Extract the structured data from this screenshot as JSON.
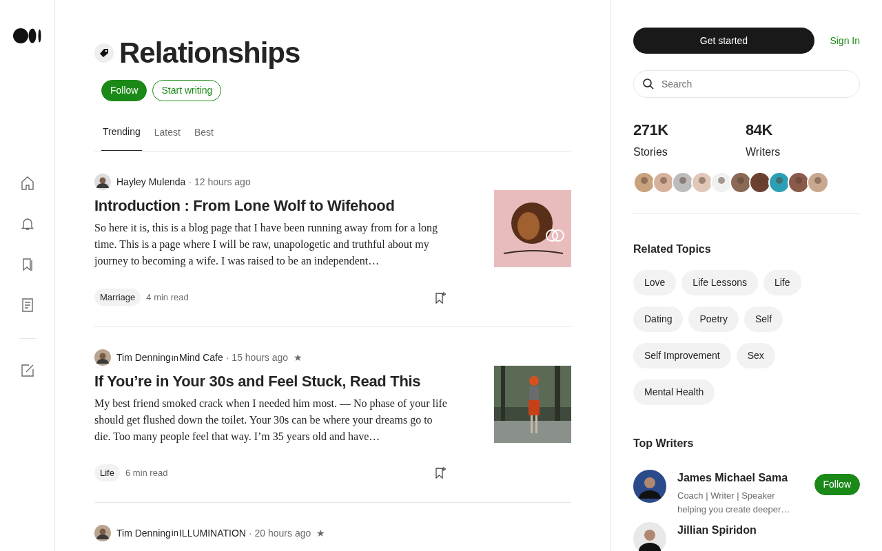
{
  "topic": {
    "title": "Relationships",
    "follow": "Follow",
    "start_writing": "Start writing"
  },
  "tabs": [
    {
      "label": "Trending",
      "selected": true
    },
    {
      "label": "Latest",
      "selected": false
    },
    {
      "label": "Best",
      "selected": false
    }
  ],
  "articles": [
    {
      "author": "Hayley Mulenda",
      "time": "· 12 hours ago",
      "title": "Introduction : From Lone Wolf to Wifehood",
      "summary": "So here it is, this is a blog page that I have been running away from for a long time. This is a page where I will be raw, unapologetic and truthful about my journey to becoming a wife. I was raised to be an independent…",
      "tag": "Marriage",
      "read_time": "4 min read"
    },
    {
      "author": "Tim Denning",
      "in": "in",
      "publication": "Mind Cafe",
      "time": "· 15 hours ago",
      "member_mark": "★",
      "title": "If You’re in Your 30s and Feel Stuck, Read This",
      "summary": "My best friend smoked crack when I needed him most. — No phase of your life should get flushed down the toilet. Your 30s can be where your dreams go to die. Too many people feel that way. I’m 35 years old and have…",
      "tag": "Life",
      "read_time": "6 min read"
    },
    {
      "author": "Tim Denning",
      "in": "in",
      "publication": "ILLUMINATION",
      "time": "· 20 hours ago",
      "member_mark": "★"
    }
  ],
  "sidebar": {
    "get_started": "Get started",
    "sign_in": "Sign In",
    "search_placeholder": "Search",
    "stats": [
      {
        "value": "271K",
        "label": "Stories"
      },
      {
        "value": "84K",
        "label": "Writers"
      }
    ],
    "related_title": "Related Topics",
    "related_topics": [
      "Love",
      "Life Lessons",
      "Life",
      "Dating",
      "Poetry",
      "Self",
      "Self Improvement",
      "Sex",
      "Mental Health"
    ],
    "top_writers_title": "Top Writers",
    "writers": [
      {
        "name": "James Michael Sama",
        "bio": "Coach | Writer | Speaker helping you create deeper…",
        "follow": "Follow"
      },
      {
        "name": "Jillian Spiridon"
      }
    ]
  }
}
